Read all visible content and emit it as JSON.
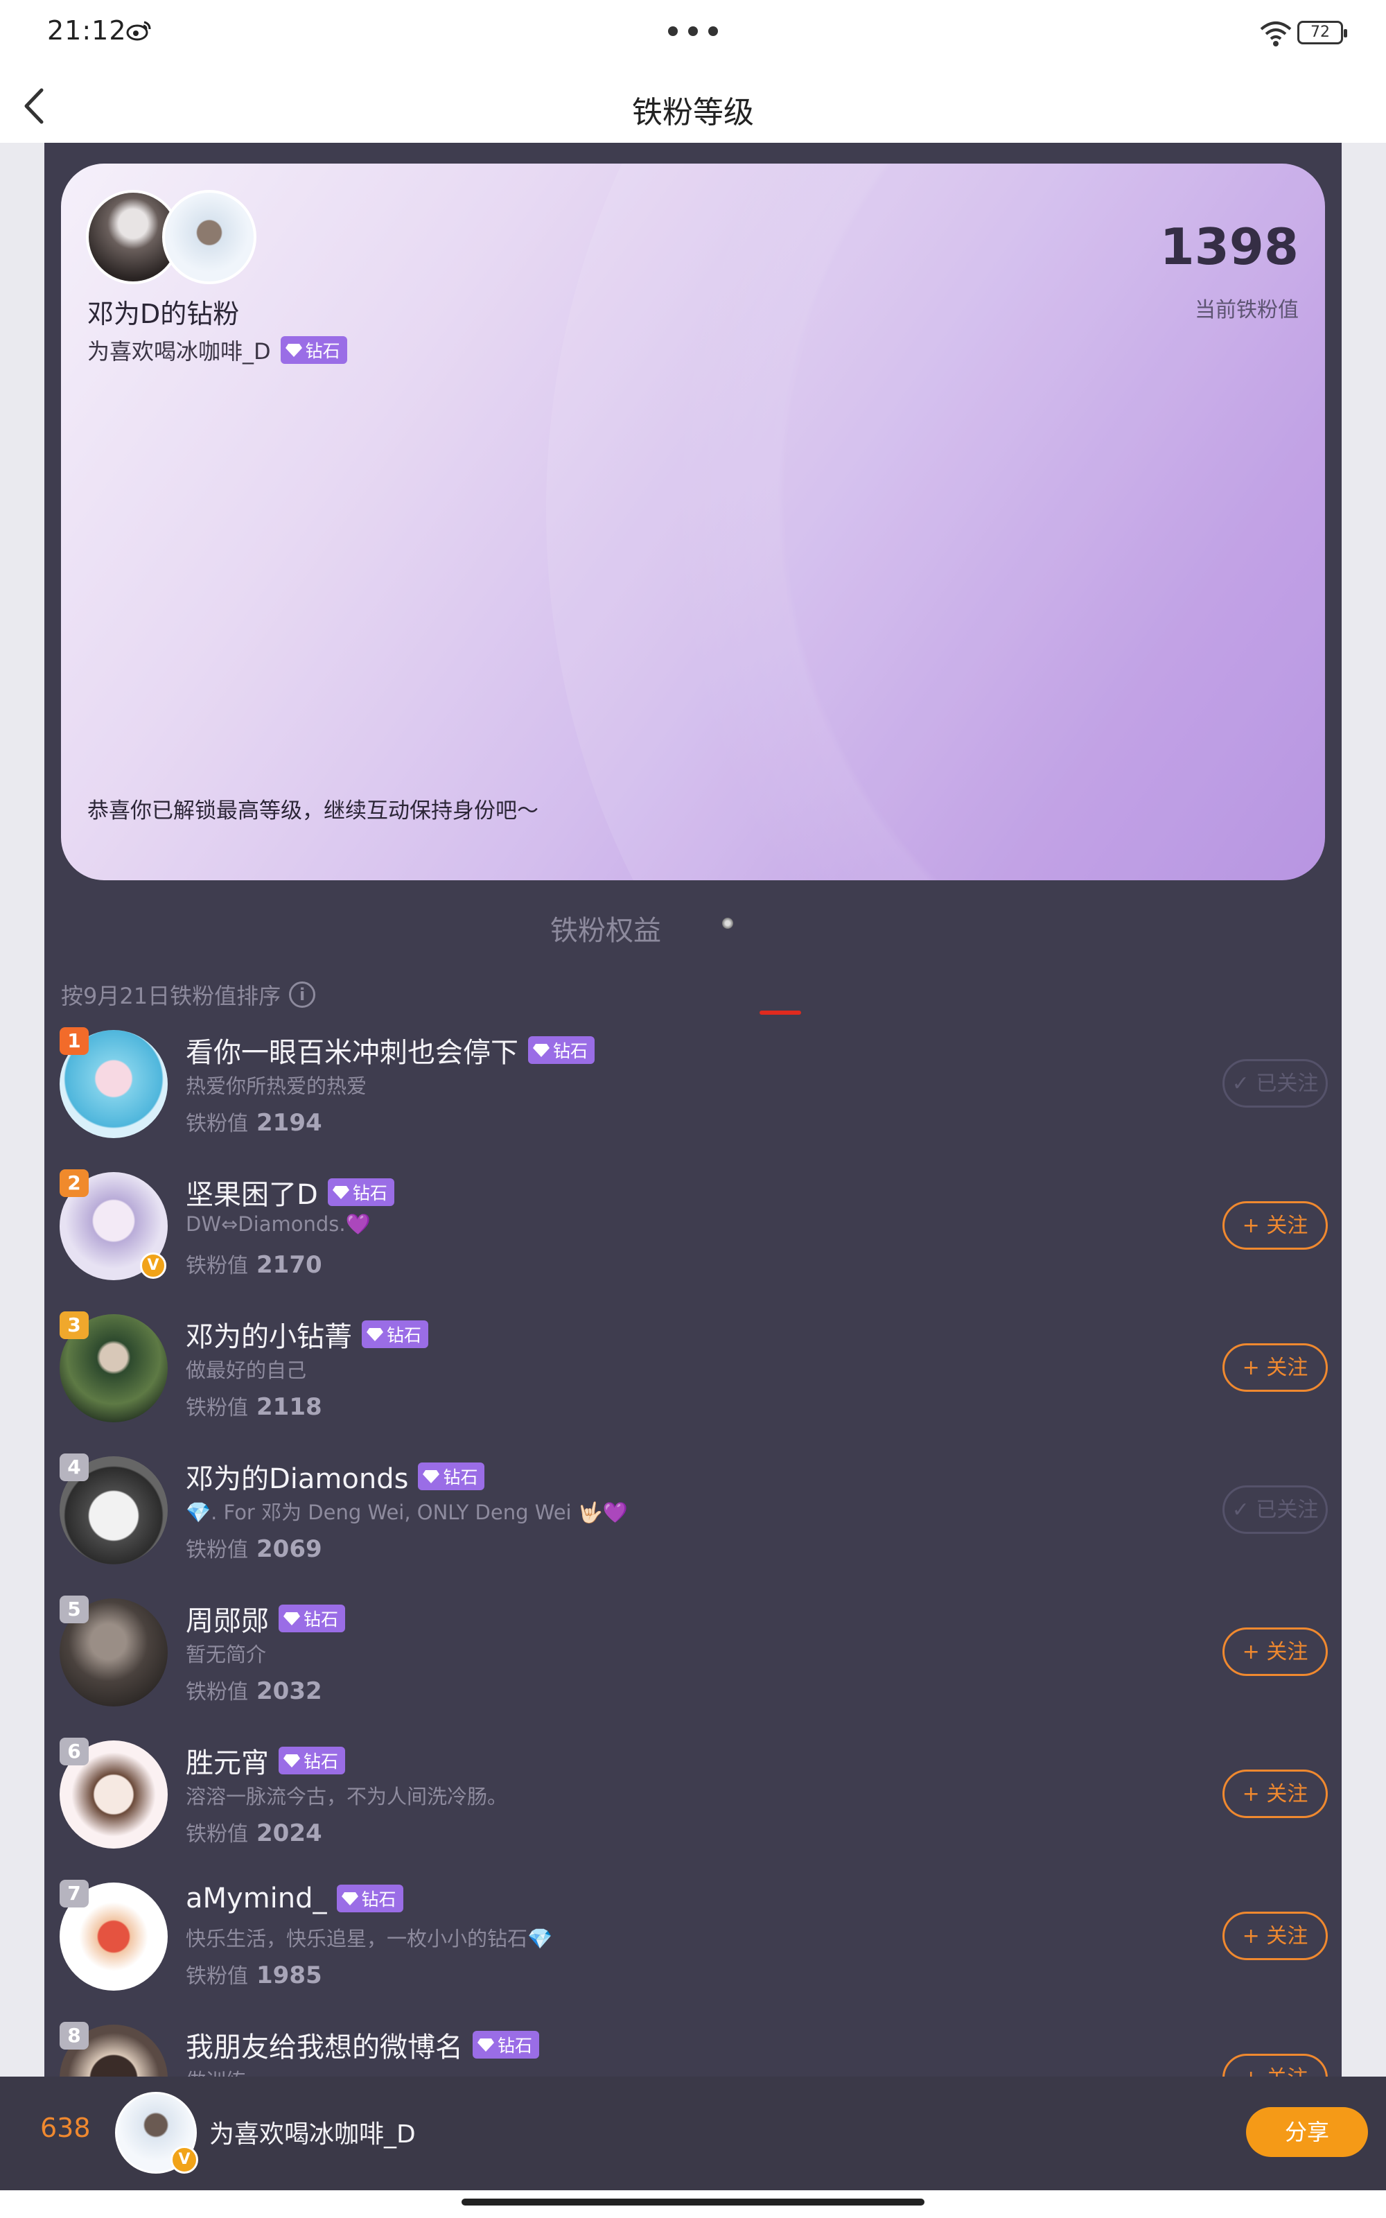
{
  "status": {
    "time": "21:12",
    "battery": "72"
  },
  "nav": {
    "title": "铁粉等级"
  },
  "card": {
    "group_name": "邓为D的钻粉",
    "user_name": "为喜欢喝冰咖啡_D",
    "user_level": "钻石",
    "score": "1398",
    "score_label": "当前铁粉值",
    "congrats": "恭喜你已解锁最高等级，继续互动保持身份吧～"
  },
  "tabs": {
    "benefits": "铁粉权益"
  },
  "sort": {
    "label": "按9月21日铁粉值排序",
    "info": "i"
  },
  "list_value_label": "铁粉值",
  "badge_label": "钻石",
  "btn_follow": "+ 关注",
  "btn_followed": "✓ 已关注",
  "ranking": [
    {
      "rank": "1",
      "name": "看你一眼百米冲刺也会停下",
      "bio": "热爱你所热爱的热爱",
      "value": "2194",
      "followed": true,
      "rank_color": "#f26b2a",
      "verified": false
    },
    {
      "rank": "2",
      "name": "坚果困了D",
      "bio": "DW⇔Diamonds.💜",
      "value": "2170",
      "followed": false,
      "rank_color": "#f08a2c",
      "verified": true
    },
    {
      "rank": "3",
      "name": "邓为的小钻菁",
      "bio": "做最好的自己",
      "value": "2118",
      "followed": false,
      "rank_color": "#f0a82c",
      "verified": false
    },
    {
      "rank": "4",
      "name": "邓为的Diamonds",
      "bio": "💎. For 邓为 Deng Wei, ONLY Deng Wei 🤟🏻💜",
      "value": "2069",
      "followed": true,
      "rank_color": "#b6b4bf",
      "verified": false
    },
    {
      "rank": "5",
      "name": "周郧郧",
      "bio": "暂无简介",
      "value": "2032",
      "followed": false,
      "rank_color": "#b6b4bf",
      "verified": false
    },
    {
      "rank": "6",
      "name": "胜元宵",
      "bio": "溶溶一脉流今古，不为人间洗冷肠。",
      "value": "2024",
      "followed": false,
      "rank_color": "#b6b4bf",
      "verified": false
    },
    {
      "rank": "7",
      "name": "aMymind_",
      "bio": "快乐生活，快乐追星，一枚小小的钻石💎",
      "value": "1985",
      "followed": false,
      "rank_color": "#b6b4bf",
      "verified": false
    },
    {
      "rank": "8",
      "name": "我朋友给我想的微博名",
      "bio": "做训练",
      "value": "",
      "followed": false,
      "rank_color": "#b6b4bf",
      "verified": false
    }
  ],
  "bottom": {
    "rank": "638",
    "name": "为喜欢喝冰咖啡_D",
    "share": "分享"
  },
  "colors": {
    "accent": "#f0892f",
    "share": "#f59a17",
    "badge": "#9a6de6",
    "panel": "#3f3d4f"
  }
}
